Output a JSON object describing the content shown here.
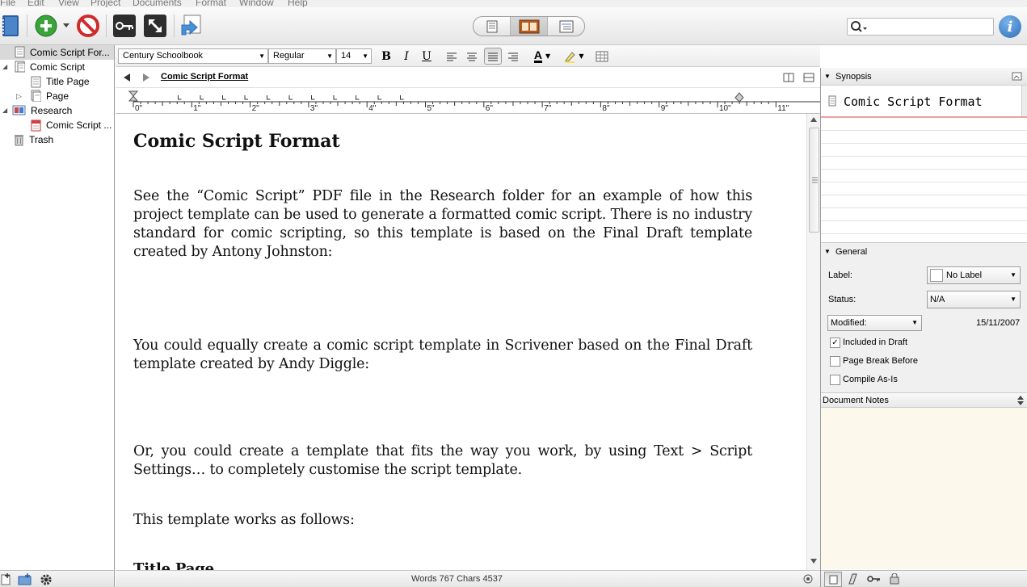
{
  "menu": [
    "File",
    "Edit",
    "View",
    "Project",
    "Documents",
    "Format",
    "Window",
    "Help"
  ],
  "toolbar": {
    "search_placeholder": ""
  },
  "binder": {
    "items": [
      {
        "label": "Comic Script For...",
        "icon": "document-icon",
        "selected": true
      },
      {
        "label": "Comic Script",
        "icon": "folder-doc-icon",
        "selected": false
      },
      {
        "label": "Title Page",
        "icon": "document-icon",
        "selected": false
      },
      {
        "label": "Page",
        "icon": "document-stack-icon",
        "selected": false
      },
      {
        "label": "Research",
        "icon": "research-folder-icon",
        "selected": false
      },
      {
        "label": "Comic Script ...",
        "icon": "pdf-icon",
        "selected": false
      },
      {
        "label": "Trash",
        "icon": "trash-icon",
        "selected": false
      }
    ]
  },
  "formatbar": {
    "font": "Century Schoolbook",
    "style": "Regular",
    "size": "14",
    "bold": "B",
    "italic": "I",
    "underline": "U",
    "text_color": "A"
  },
  "editor": {
    "title": "Comic Script Format",
    "ruler_labels": [
      "0\"",
      "1\"",
      "2\"",
      "3\"",
      "4\"",
      "5\"",
      "6\"",
      "7\"",
      "8\"",
      "9\"",
      "10\"",
      "11\""
    ],
    "heading": "Comic Script Format",
    "paragraphs": [
      "See the “Comic Script” PDF file in the Research folder for an example of how this project template can be used to generate a formatted comic script. There is no industry standard for comic scripting, so this template is based on the Final Draft template created by Antony Johnston:",
      "You could equally create a comic script template in Scrivener based on the Final Draft template created by Andy Diggle:",
      "Or, you could create a template that fits the way you work, by using Text > Script Settings… to completely customise the script template.",
      "This template works as follows:"
    ],
    "subheading": "Title Page",
    "status": "Words 767 Chars 4537"
  },
  "inspector": {
    "synopsis_label": "Synopsis",
    "synopsis_title": "Comic Script Format",
    "general_label": "General",
    "label_field": "Label:",
    "label_value": "No Label",
    "status_field": "Status:",
    "status_value": "N/A",
    "modified_label": "Modified:",
    "modified_date": "15/11/2007",
    "included_in_draft": "Included in Draft",
    "page_break_before": "Page Break Before",
    "compile_as_is": "Compile As-Is",
    "notes_label": "Document Notes"
  },
  "colors": {
    "accent_blue": "#2a6fb8",
    "add_green": "#3aa33a",
    "stop_red": "#d02b2b",
    "notes_bg": "#fdf8ec",
    "synopsis_underline": "#e8a3a3"
  }
}
